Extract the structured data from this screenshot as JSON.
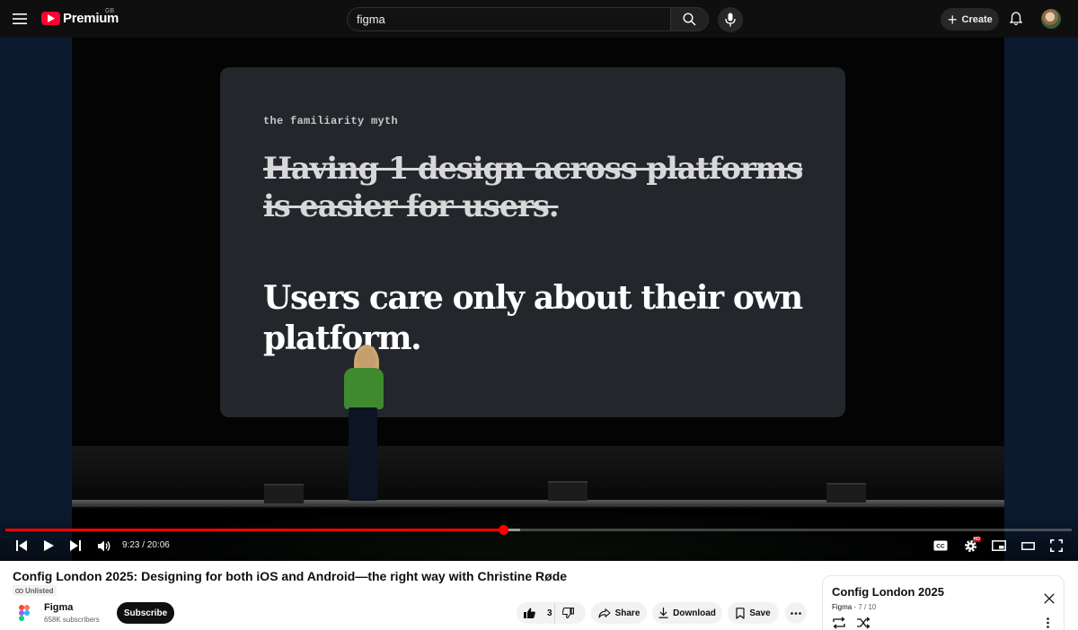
{
  "masthead": {
    "logo_text": "Premium",
    "country_code": "GB",
    "search_value": "figma",
    "create_label": "Create"
  },
  "player": {
    "slide": {
      "kicker": "the familiarity myth",
      "struck_text": "Having 1 design across platforms is easier for users.",
      "statement": "Users care only about their own platform."
    },
    "current_time": "9:23",
    "duration": "20:06",
    "time_display": "9:23 / 20:06",
    "progress_fraction": 0.467,
    "buffered_fraction": 0.483,
    "quality_badge": "HD"
  },
  "video": {
    "title": "Config London 2025: Designing for both iOS and Android—the right way with Christine Røde",
    "visibility": "Unlisted"
  },
  "channel": {
    "name": "Figma",
    "subscribers": "658K subscribers",
    "subscribe_label": "Subscribe"
  },
  "actions": {
    "like_count": "3",
    "share_label": "Share",
    "download_label": "Download",
    "save_label": "Save"
  },
  "playlist": {
    "title": "Config London 2025",
    "channel": "Figma",
    "separator": " - ",
    "position": "7 / 10"
  },
  "colors": {
    "accent": "#ff0000",
    "masthead_bg": "#0f0f0f",
    "speaker_shirt": "#3f8a2f"
  }
}
